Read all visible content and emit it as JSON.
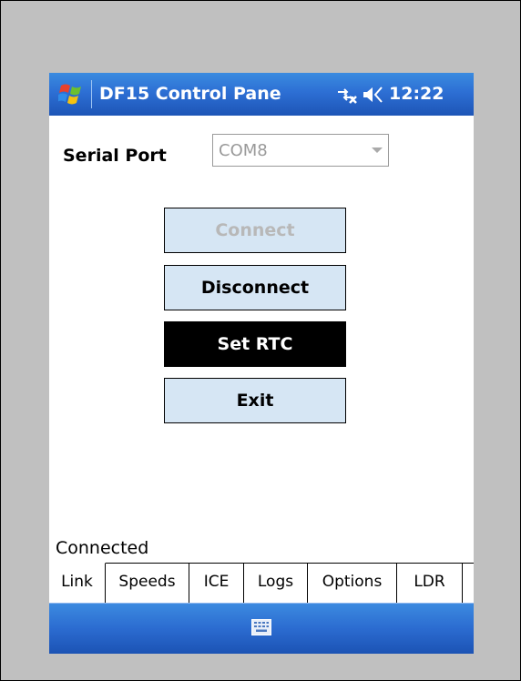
{
  "titlebar": {
    "title": "DF15 Control Pane",
    "clock": "12:22",
    "icons": [
      "windows-start-flag-icon",
      "connectivity-icon",
      "volume-icon"
    ]
  },
  "serial": {
    "label": "Serial Port",
    "value": "COM8"
  },
  "buttons": {
    "connect": "Connect",
    "disconnect": "Disconnect",
    "set_rtc": "Set RTC",
    "exit": "Exit"
  },
  "status": "Connected",
  "tabs": [
    {
      "label": "Link",
      "active": true
    },
    {
      "label": "Speeds",
      "active": false
    },
    {
      "label": "ICE",
      "active": false
    },
    {
      "label": "Logs",
      "active": false
    },
    {
      "label": "Options",
      "active": false
    },
    {
      "label": "LDR",
      "active": false
    }
  ],
  "colors": {
    "titlebar": "#2d6fd4",
    "button_face": "#d6e6f4",
    "focused_button": "#000000",
    "background": "#c0c0c0"
  }
}
